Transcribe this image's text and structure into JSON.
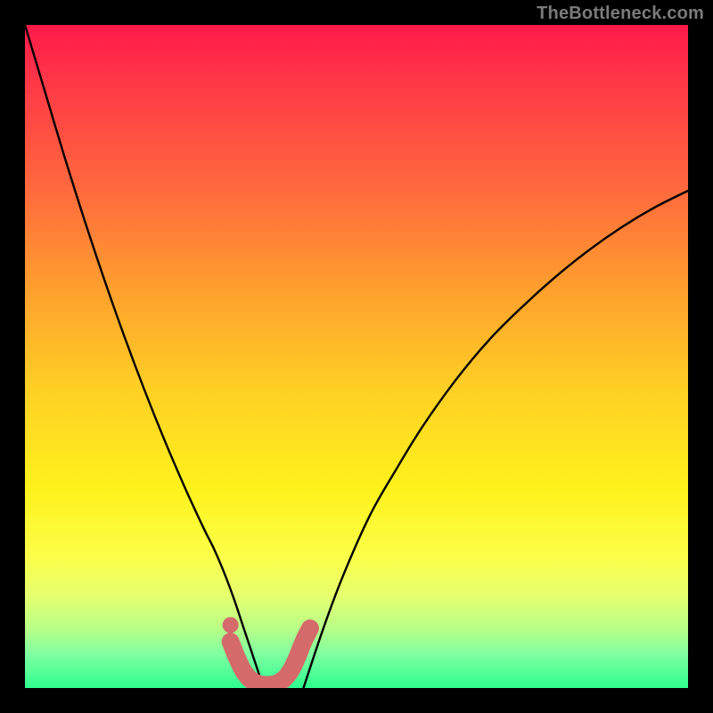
{
  "watermark": {
    "text": "TheBottleneck.com"
  },
  "chart_data": {
    "type": "line",
    "title": "",
    "xlabel": "",
    "ylabel": "",
    "xlim": [
      0,
      100
    ],
    "ylim": [
      0,
      100
    ],
    "series": [
      {
        "name": "left-curve",
        "x": [
          0,
          3,
          6,
          9,
          12,
          15,
          18,
          21,
          24,
          27,
          28.5,
          30,
          31.5,
          33,
          34.5,
          36
        ],
        "values": [
          100,
          90,
          80,
          70.5,
          61.5,
          53,
          45,
          37.5,
          30.5,
          24,
          21,
          17.5,
          13.5,
          9,
          4.5,
          0
        ]
      },
      {
        "name": "right-curve",
        "x": [
          42,
          45,
          48,
          52,
          56,
          60,
          65,
          70,
          75,
          80,
          85,
          90,
          95,
          100
        ],
        "values": [
          0,
          9,
          17,
          26,
          33,
          39.5,
          46.5,
          52.5,
          57.5,
          62,
          66,
          69.5,
          72.5,
          75
        ]
      },
      {
        "name": "marker-bar",
        "x": [
          31,
          32,
          33,
          34,
          35,
          36,
          37,
          38,
          39,
          40,
          41,
          42,
          43
        ],
        "values": [
          7,
          4.5,
          2.5,
          1.3,
          0.7,
          0.5,
          0.5,
          0.7,
          1.3,
          2.5,
          4.5,
          7,
          9
        ]
      },
      {
        "name": "marker-dot",
        "x": [
          31
        ],
        "values": [
          9.5
        ]
      }
    ],
    "colors": {
      "curve": "#000000",
      "marker": "#d46a6a"
    }
  }
}
